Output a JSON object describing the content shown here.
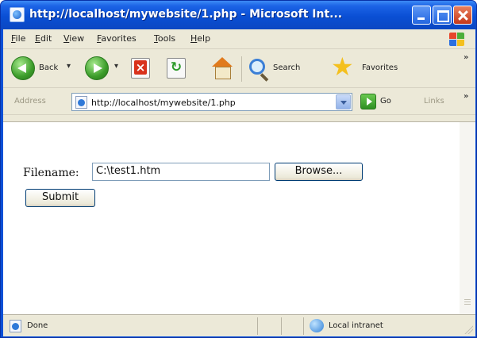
{
  "window": {
    "title": "http://localhost/mywebsite/1.php - Microsoft Int...",
    "controls": [
      "minimize-icon",
      "maximize-icon",
      "close-icon"
    ]
  },
  "menubar": {
    "items": [
      {
        "underline": "F",
        "rest": "ile"
      },
      {
        "underline": "E",
        "rest": "dit"
      },
      {
        "underline": "V",
        "rest": "iew"
      },
      {
        "underline": "F",
        "rest": "avorites",
        "prefix": ""
      },
      {
        "underline": "T",
        "rest": "ools"
      },
      {
        "underline": "H",
        "rest": "elp"
      }
    ]
  },
  "toolbar": {
    "back_label": "Back",
    "search_label": "Search",
    "favorites_label": "Favorites",
    "icons": [
      "back-icon",
      "forward-icon",
      "stop-icon",
      "refresh-icon",
      "home-icon",
      "search-icon",
      "favorites-icon"
    ]
  },
  "addressbar": {
    "label": "Address",
    "url": "http://localhost/mywebsite/1.php",
    "go_label": "Go",
    "links_label": "Links"
  },
  "form": {
    "label": "Filename:",
    "file_value": "C:\\test1.htm",
    "browse_label": "Browse...",
    "submit_label": "Submit"
  },
  "statusbar": {
    "status": "Done",
    "zone": "Local intranet"
  },
  "colors": {
    "titlebar": "#0a50d6",
    "chrome": "#ece9d8",
    "accent_green": "#3c9d2a"
  }
}
